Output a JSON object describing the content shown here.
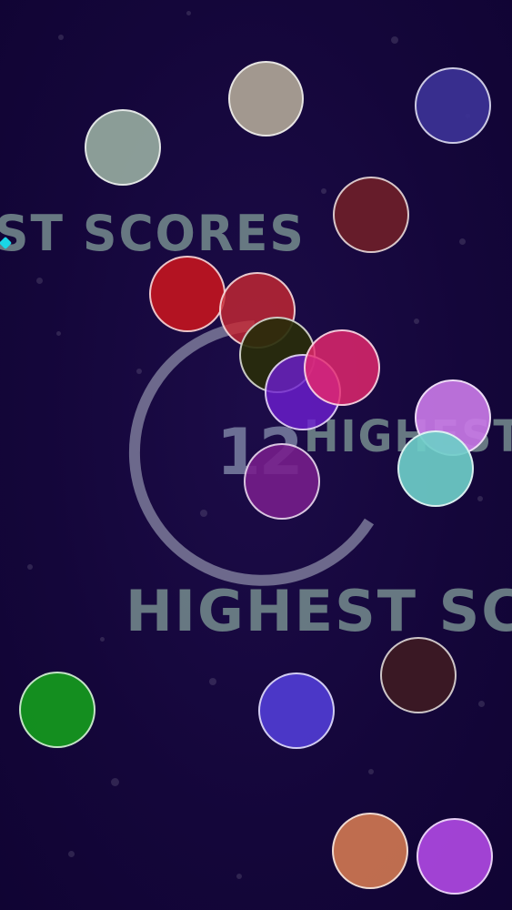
{
  "hud": {
    "label_top": "ST SCORES",
    "label_mid": "HIGHEST",
    "label_bottom": "HIGHEST SCOR",
    "score": "12"
  },
  "colors": {
    "background": "#15073a",
    "label": "#6c7f86",
    "ring": "#8a8aa6",
    "player": "#19d6e6"
  },
  "bubbles": [
    {
      "name": "bubble-sage",
      "color": "rgba(150,170,160,0.92)"
    },
    {
      "name": "bubble-beige",
      "color": "rgba(175,165,150,0.92)"
    },
    {
      "name": "bubble-indigo",
      "color": "rgba(60,50,150,0.92)"
    },
    {
      "name": "bubble-maroon",
      "color": "rgba(110,30,40,0.92)"
    },
    {
      "name": "bubble-red",
      "color": "rgba(200,20,30,0.88)"
    },
    {
      "name": "bubble-crimson",
      "color": "rgba(200,40,50,0.80)"
    },
    {
      "name": "bubble-olive-dark",
      "color": "rgba(40,45,10,0.92)"
    },
    {
      "name": "bubble-violet",
      "color": "rgba(110,30,210,0.80)"
    },
    {
      "name": "bubble-pink",
      "color": "rgba(230,40,110,0.82)"
    },
    {
      "name": "bubble-lilac",
      "color": "rgba(200,120,230,0.92)"
    },
    {
      "name": "bubble-teal",
      "color": "rgba(110,205,200,0.92)"
    },
    {
      "name": "bubble-purple",
      "color": "rgba(120,30,140,0.88)"
    },
    {
      "name": "bubble-green",
      "color": "rgba(20,150,30,0.95)"
    },
    {
      "name": "bubble-blue",
      "color": "rgba(80,60,210,0.92)"
    },
    {
      "name": "bubble-dark-brown",
      "color": "rgba(60,25,35,0.95)"
    },
    {
      "name": "bubble-orange",
      "color": "rgba(200,115,80,0.95)"
    },
    {
      "name": "bubble-magenta",
      "color": "rgba(170,70,220,0.95)"
    }
  ]
}
